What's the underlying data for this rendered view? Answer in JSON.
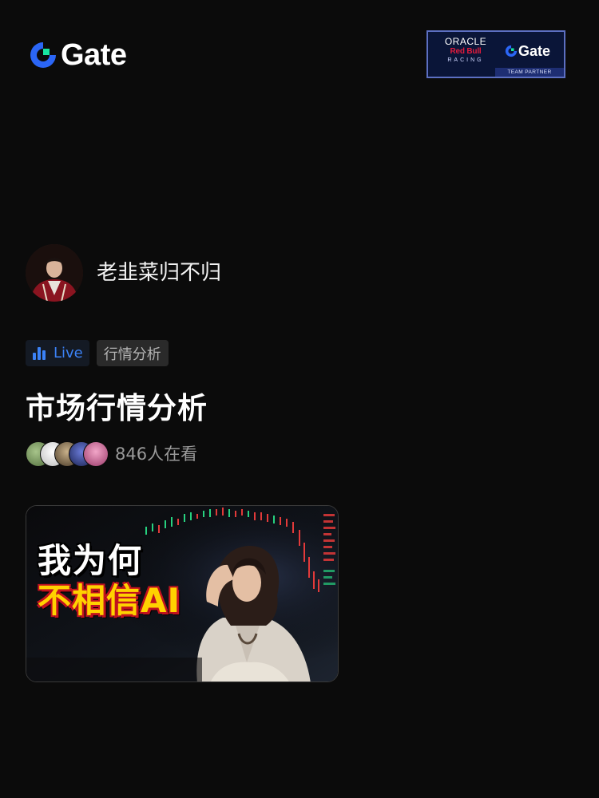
{
  "brand": {
    "name": "Gate"
  },
  "partner_badge": {
    "oracle": "ORACLE",
    "red_bull": "Red Bull",
    "racing": "RACING",
    "gate": "Gate",
    "team_partner": "TEAM PARTNER"
  },
  "streamer": {
    "name": "老韭菜归不归"
  },
  "tags": {
    "live": "Live",
    "category": "行情分析"
  },
  "stream": {
    "title": "市场行情分析",
    "viewer_count": "846人在看"
  },
  "thumbnail": {
    "line1": "我为何",
    "line2": "不相信AI"
  },
  "colors": {
    "background": "#0b0b0b",
    "accent_blue": "#3b82f6",
    "gate_green": "#17e5a1"
  }
}
